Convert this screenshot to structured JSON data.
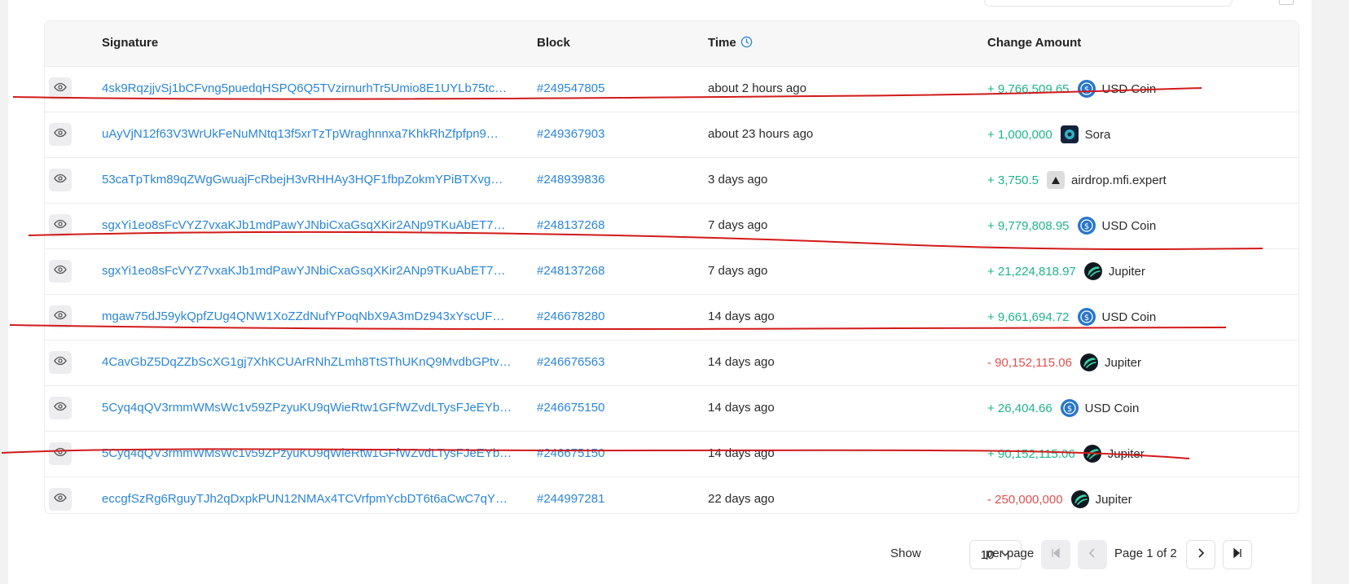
{
  "table": {
    "headers": {
      "signature": "Signature",
      "block": "Block",
      "time": "Time",
      "change": "Change Amount"
    },
    "rows": [
      {
        "signature": "4sk9RqzjjvSj1bCFvng5puedqHSPQ6Q5TVzirnurhTr5Umio8E1UYLb75tc…",
        "block": "#249547805",
        "time": "about 2 hours ago",
        "amount": "+ 9,766,509.65",
        "sign": "pos",
        "token": "USD Coin",
        "icon": "usdc-icon"
      },
      {
        "signature": "uAyVjN12f63V3WrUkFeNuMNtq13f5xrTzTpWraghnnxa7KhkRhZfpfpn9…",
        "block": "#249367903",
        "time": "about 23 hours ago",
        "amount": "+ 1,000,000",
        "sign": "pos",
        "token": "Sora",
        "icon": "sora-icon"
      },
      {
        "signature": "53caTpTkm89qZWgGwuajFcRbejH3vRHHAy3HQF1fbpZokmYPiBTXvg…",
        "block": "#248939836",
        "time": "3 days ago",
        "amount": "+ 3,750.5",
        "sign": "pos",
        "token": "airdrop.mfi.expert",
        "icon": "airdrop-icon"
      },
      {
        "signature": "sgxYi1eo8sFcVYZ7vxaKJb1mdPawYJNbiCxaGsqXKir2ANp9TKuAbET7…",
        "block": "#248137268",
        "time": "7 days ago",
        "amount": "+ 9,779,808.95",
        "sign": "pos",
        "token": "USD Coin",
        "icon": "usdc-icon"
      },
      {
        "signature": "sgxYi1eo8sFcVYZ7vxaKJb1mdPawYJNbiCxaGsqXKir2ANp9TKuAbET7…",
        "block": "#248137268",
        "time": "7 days ago",
        "amount": "+ 21,224,818.97",
        "sign": "pos",
        "token": "Jupiter",
        "icon": "jupiter-icon"
      },
      {
        "signature": "mgaw75dJ59ykQpfZUg4QNW1XoZZdNufYPoqNbX9A3mDz943xYscUF…",
        "block": "#246678280",
        "time": "14 days ago",
        "amount": "+ 9,661,694.72",
        "sign": "pos",
        "token": "USD Coin",
        "icon": "usdc-icon"
      },
      {
        "signature": "4CavGbZ5DqZZbScXG1gj7XhKCUArRNhZLmh8TtSThUKnQ9MvdbGPtv…",
        "block": "#246676563",
        "time": "14 days ago",
        "amount": "- 90,152,115.06",
        "sign": "neg",
        "token": "Jupiter",
        "icon": "jupiter-icon"
      },
      {
        "signature": "5Cyq4qQV3rmmWMsWc1v59ZPzyuKU9qWieRtw1GFfWZvdLTysFJeEYb…",
        "block": "#246675150",
        "time": "14 days ago",
        "amount": "+ 26,404.66",
        "sign": "pos",
        "token": "USD Coin",
        "icon": "usdc-icon"
      },
      {
        "signature": "5Cyq4qQV3rmmWMsWc1v59ZPzyuKU9qWieRtw1GFfWZvdLTysFJeEYb…",
        "block": "#246675150",
        "time": "14 days ago",
        "amount": "+ 90,152,115.06",
        "sign": "pos",
        "token": "Jupiter",
        "icon": "jupiter-icon"
      },
      {
        "signature": "eccgfSzRg6RguyTJh2qDxpkPUN12NMAx4TCVrfpmYcbDT6t6aCwC7qY…",
        "block": "#244997281",
        "time": "22 days ago",
        "amount": "- 250,000,000",
        "sign": "neg",
        "token": "Jupiter",
        "icon": "jupiter-icon"
      }
    ]
  },
  "pagination": {
    "show_label": "Show",
    "page_size": "10",
    "per_page_label": "per page",
    "page_text": "Page 1 of 2"
  },
  "colors": {
    "link": "#2b86d6",
    "positive": "#1fb58a",
    "negative": "#e05050",
    "annotation": "#d21a1a"
  }
}
